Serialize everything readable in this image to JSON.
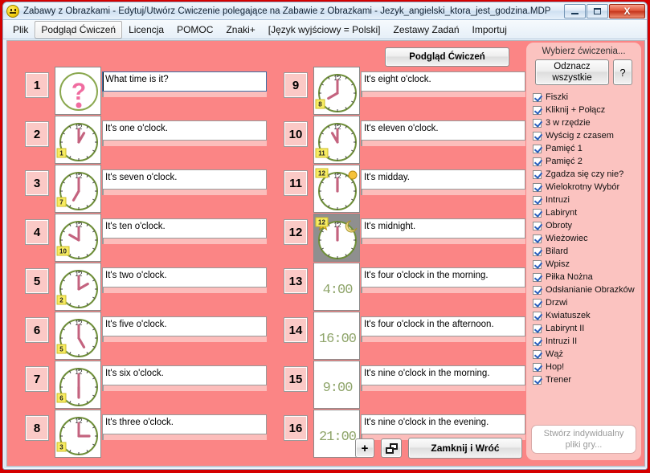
{
  "window": {
    "title": "Zabawy z Obrazkami - Edytuj/Utwórz Ćwiczenie polegające na Zabawie z Obrazkami - Jezyk_angielski_ktora_jest_godzina.MDP",
    "icon": "smiley-face-icon",
    "controls": {
      "minimize": "minimize-icon",
      "maximize": "maximize-icon",
      "close": "X"
    }
  },
  "menu": {
    "items": [
      {
        "label": "Plik",
        "active": false
      },
      {
        "label": "Podgląd Ćwiczeń",
        "active": true
      },
      {
        "label": "Licencja",
        "active": false
      },
      {
        "label": "POMOC",
        "active": false
      },
      {
        "label": "Znaki+",
        "active": false
      },
      {
        "label": "[Język wyjściowy = Polski]",
        "active": false
      },
      {
        "label": "Zestawy Zadań",
        "active": false
      },
      {
        "label": "Importuj",
        "active": false
      }
    ]
  },
  "toolbar": {
    "preview_label": "Podgląd Ćwiczeń"
  },
  "items": [
    {
      "num": "1",
      "text": "What time is it?",
      "clock": "question",
      "focused": true
    },
    {
      "num": "2",
      "text": "It's one o'clock.",
      "clock": "analog",
      "hour": 1,
      "badge": "1",
      "focused": false
    },
    {
      "num": "3",
      "text": "It's seven o'clock.",
      "clock": "analog",
      "hour": 7,
      "badge": "7",
      "focused": false
    },
    {
      "num": "4",
      "text": "It's ten o'clock.",
      "clock": "analog",
      "hour": 10,
      "badge": "10",
      "focused": false
    },
    {
      "num": "5",
      "text": "It's two o'clock.",
      "clock": "analog",
      "hour": 2,
      "badge": "2",
      "focused": false
    },
    {
      "num": "6",
      "text": "It's five o'clock.",
      "clock": "analog",
      "hour": 5,
      "badge": "5",
      "focused": false
    },
    {
      "num": "7",
      "text": "It's six o'clock.",
      "clock": "analog",
      "hour": 6,
      "badge": "6",
      "focused": false
    },
    {
      "num": "8",
      "text": "It's three o'clock.",
      "clock": "analog",
      "hour": 3,
      "badge": "3",
      "focused": false
    },
    {
      "num": "9",
      "text": "It's eight o'clock.",
      "clock": "analog",
      "hour": 8,
      "badge": "8",
      "focused": false
    },
    {
      "num": "10",
      "text": "It's eleven o'clock.",
      "clock": "analog",
      "hour": 11,
      "badge": "11",
      "focused": false
    },
    {
      "num": "11",
      "text": "It's midday.",
      "clock": "analog",
      "hour": 12,
      "badge": "12",
      "decor": "sun",
      "focused": false
    },
    {
      "num": "12",
      "text": "It's midnight.",
      "clock": "analog",
      "hour": 12,
      "badge": "12",
      "decor": "moon",
      "focused": false
    },
    {
      "num": "13",
      "text": "It's four o'clock in the morning.",
      "clock": "digital",
      "display": "4:00",
      "focused": false
    },
    {
      "num": "14",
      "text": "It's four o'clock in the afternoon.",
      "clock": "digital",
      "display": "16:00",
      "focused": false
    },
    {
      "num": "15",
      "text": "It's nine o'clock in the morning.",
      "clock": "digital",
      "display": "9:00",
      "focused": false
    },
    {
      "num": "16",
      "text": "It's nine o'clock in the evening.",
      "clock": "digital",
      "display": "21:00",
      "focused": false
    }
  ],
  "sidebar": {
    "title": "Wybierz ćwiczenia...",
    "uncheck_all_label": "Odznacz wszystkie",
    "help_label": "?",
    "create_label": "Stwórz indywidualny pliki gry...",
    "exercises": [
      {
        "label": "Fiszki",
        "checked": true
      },
      {
        "label": "Kliknij + Połącz",
        "checked": true
      },
      {
        "label": "3 w rzędzie",
        "checked": true
      },
      {
        "label": "Wyścig z czasem",
        "checked": true
      },
      {
        "label": "Pamięć 1",
        "checked": true
      },
      {
        "label": "Pamięć 2",
        "checked": true
      },
      {
        "label": "Zgadza się czy nie?",
        "checked": true
      },
      {
        "label": "Wielokrotny Wybór",
        "checked": true
      },
      {
        "label": "Intruzi",
        "checked": true
      },
      {
        "label": "Labirynt",
        "checked": true
      },
      {
        "label": "Obroty",
        "checked": true
      },
      {
        "label": "Wieżowiec",
        "checked": true
      },
      {
        "label": "Bilard",
        "checked": true
      },
      {
        "label": "Wpisz",
        "checked": true
      },
      {
        "label": "Piłka Nożna",
        "checked": true
      },
      {
        "label": "Odsłanianie Obrazków",
        "checked": true
      },
      {
        "label": "Drzwi",
        "checked": true
      },
      {
        "label": "Kwiatuszek",
        "checked": true
      },
      {
        "label": "Labirynt II",
        "checked": true
      },
      {
        "label": "Intruzi II",
        "checked": true
      },
      {
        "label": "Wąż",
        "checked": true
      },
      {
        "label": "Hop!",
        "checked": true
      },
      {
        "label": "Trener",
        "checked": true
      }
    ]
  },
  "bottom": {
    "add_label": "+",
    "duplicate_icon": "duplicate-icon",
    "close_label": "Zamknij i Wróć"
  },
  "colors": {
    "background": "#fb8585",
    "sidebar": "#fbc3c0",
    "number_box": "#fbc9c6",
    "subbar": "#fcbdbb"
  }
}
